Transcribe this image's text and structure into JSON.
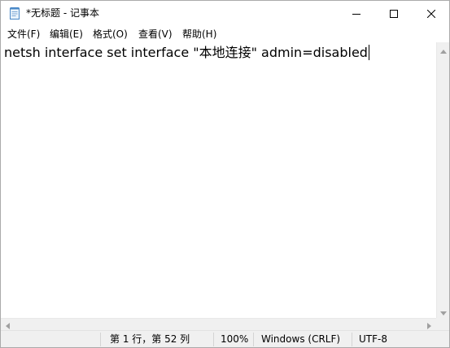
{
  "window": {
    "title": "*无标题 - 记事本"
  },
  "menu": {
    "file": "文件(F)",
    "edit": "编辑(E)",
    "format": "格式(O)",
    "view": "查看(V)",
    "help": "帮助(H)"
  },
  "editor": {
    "content": "netsh interface set interface \"本地连接\" admin=disabled"
  },
  "statusbar": {
    "position": "第 1 行，第 52 列",
    "zoom": "100%",
    "line_ending": "Windows (CRLF)",
    "encoding": "UTF-8"
  },
  "icons": {
    "app": "notepad-icon",
    "minimize": "minimize-icon",
    "maximize": "maximize-icon",
    "close": "close-icon"
  }
}
